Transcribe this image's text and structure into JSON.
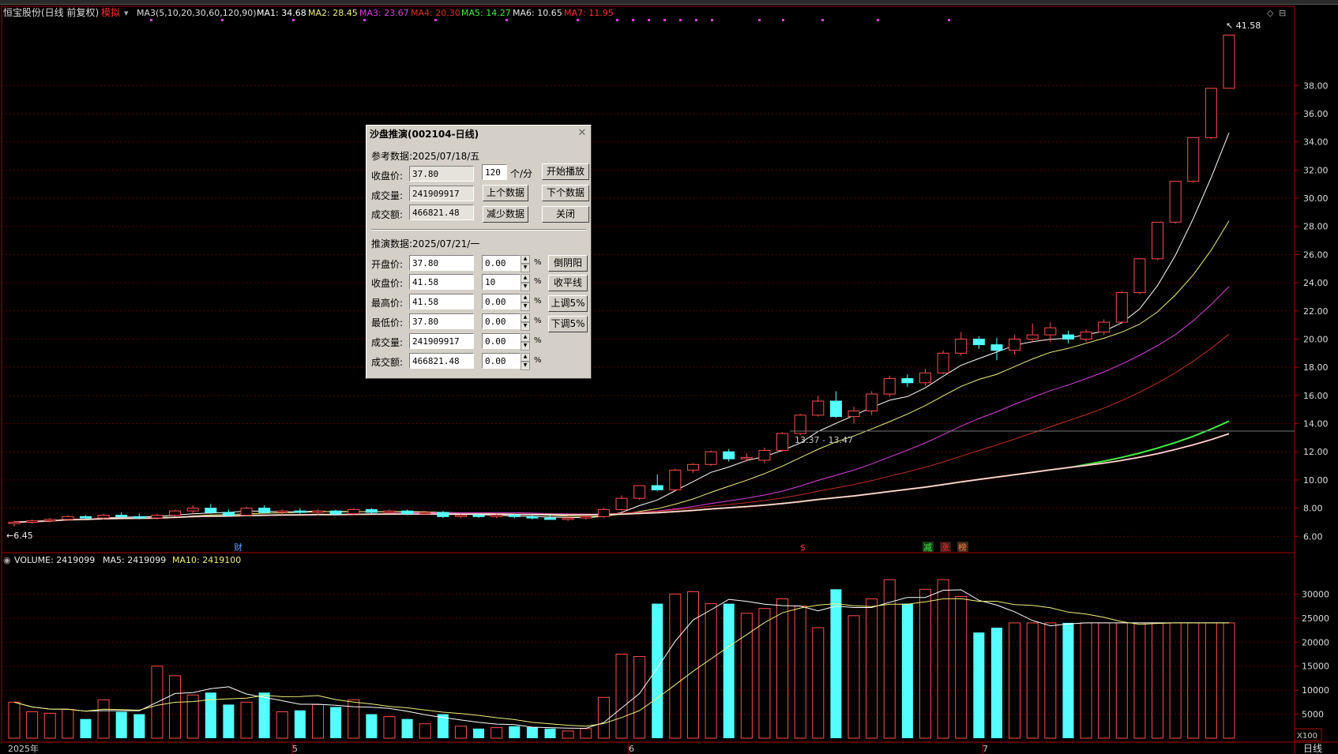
{
  "header": {
    "stock": "恒宝股份(日线 前复权)",
    "mode": "模拟",
    "ma_set": "MA3(5,10,20,30,60,120,90)",
    "ma": [
      {
        "label": "MA1: 34.68",
        "color": "#ffffff"
      },
      {
        "label": "MA2: 28.45",
        "color": "#f0f07a"
      },
      {
        "label": "MA3: 23.67",
        "color": "#e040e0"
      },
      {
        "label": "MA4: 20.30",
        "color": "#e03020"
      },
      {
        "label": "MA5: 14.27",
        "color": "#40f040"
      },
      {
        "label": "MA6: 10.65",
        "color": "#e8e8e8"
      },
      {
        "label": "MA7: 11.95",
        "color": "#ff3030"
      }
    ]
  },
  "price_axis": [
    "38.00",
    "36.00",
    "34.00",
    "32.00",
    "30.00",
    "28.00",
    "26.00",
    "24.00",
    "22.00",
    "20.00",
    "18.00",
    "16.00",
    "14.00",
    "12.00",
    "10.00",
    "8.00",
    "6.00"
  ],
  "price_ticks": [
    38,
    36,
    34,
    32,
    30,
    28,
    26,
    24,
    22,
    20,
    18,
    16,
    14,
    12,
    10,
    8,
    6
  ],
  "annotations": {
    "max": "41.58",
    "min": "6.45",
    "crosshair": "13.37 - 13.47",
    "marks": [
      {
        "text": "财",
        "color": "#5aa0ff"
      },
      {
        "text": "$",
        "color": "#ff3030"
      },
      {
        "text": "减",
        "color": "#40f040"
      },
      {
        "text": "涨",
        "color": "#ff3030"
      },
      {
        "text": "榜",
        "color": "#ff8040"
      }
    ]
  },
  "volume_header": {
    "volume": "VOLUME: 2419099",
    "ma5": "MA5: 2419099",
    "ma10": "MA10: 2419100"
  },
  "volume_axis": [
    "30000",
    "25000",
    "20000",
    "15000",
    "10000",
    "5000"
  ],
  "volume_ticks": [
    30000,
    25000,
    20000,
    15000,
    10000,
    5000
  ],
  "volume_unit": "X100",
  "time_axis": [
    {
      "label": "2025年"
    },
    {
      "label": "5"
    },
    {
      "label": "6"
    },
    {
      "label": "7"
    }
  ],
  "period": "日线",
  "chart_data": {
    "type": "candlestick",
    "bars": [
      {
        "o": 6.9,
        "h": 7.1,
        "l": 6.7,
        "c": 7.0,
        "v": 7500
      },
      {
        "o": 7.0,
        "h": 7.2,
        "l": 6.9,
        "c": 7.1,
        "v": 5500
      },
      {
        "o": 7.1,
        "h": 7.3,
        "l": 7.0,
        "c": 7.2,
        "v": 5200
      },
      {
        "o": 7.2,
        "h": 7.5,
        "l": 7.1,
        "c": 7.4,
        "v": 6000
      },
      {
        "o": 7.4,
        "h": 7.5,
        "l": 7.2,
        "c": 7.3,
        "v": 4000
      },
      {
        "o": 7.3,
        "h": 7.6,
        "l": 7.2,
        "c": 7.5,
        "v": 8000
      },
      {
        "o": 7.5,
        "h": 7.7,
        "l": 7.3,
        "c": 7.4,
        "v": 5500
      },
      {
        "o": 7.4,
        "h": 7.6,
        "l": 7.2,
        "c": 7.3,
        "v": 5000
      },
      {
        "o": 7.3,
        "h": 7.6,
        "l": 7.2,
        "c": 7.5,
        "v": 15000
      },
      {
        "o": 7.5,
        "h": 7.9,
        "l": 7.4,
        "c": 7.8,
        "v": 13000
      },
      {
        "o": 7.8,
        "h": 8.2,
        "l": 7.6,
        "c": 8.0,
        "v": 9000
      },
      {
        "o": 8.0,
        "h": 8.3,
        "l": 7.6,
        "c": 7.7,
        "v": 9500
      },
      {
        "o": 7.7,
        "h": 7.9,
        "l": 7.4,
        "c": 7.5,
        "v": 7000
      },
      {
        "o": 7.5,
        "h": 8.1,
        "l": 7.4,
        "c": 8.0,
        "v": 7500
      },
      {
        "o": 8.0,
        "h": 8.2,
        "l": 7.6,
        "c": 7.7,
        "v": 9500
      },
      {
        "o": 7.7,
        "h": 7.9,
        "l": 7.5,
        "c": 7.8,
        "v": 5500
      },
      {
        "o": 7.8,
        "h": 8.0,
        "l": 7.6,
        "c": 7.7,
        "v": 5800
      },
      {
        "o": 7.7,
        "h": 7.9,
        "l": 7.5,
        "c": 7.8,
        "v": 7000
      },
      {
        "o": 7.8,
        "h": 7.9,
        "l": 7.5,
        "c": 7.6,
        "v": 6500
      },
      {
        "o": 7.6,
        "h": 8.0,
        "l": 7.5,
        "c": 7.9,
        "v": 8000
      },
      {
        "o": 7.9,
        "h": 8.0,
        "l": 7.6,
        "c": 7.7,
        "v": 5000
      },
      {
        "o": 7.7,
        "h": 7.9,
        "l": 7.6,
        "c": 7.8,
        "v": 4500
      },
      {
        "o": 7.8,
        "h": 7.9,
        "l": 7.5,
        "c": 7.6,
        "v": 4000
      },
      {
        "o": 7.6,
        "h": 7.8,
        "l": 7.5,
        "c": 7.7,
        "v": 3000
      },
      {
        "o": 7.7,
        "h": 7.8,
        "l": 7.3,
        "c": 7.4,
        "v": 5000
      },
      {
        "o": 7.4,
        "h": 7.6,
        "l": 7.3,
        "c": 7.5,
        "v": 2500
      },
      {
        "o": 7.5,
        "h": 7.6,
        "l": 7.3,
        "c": 7.4,
        "v": 2000
      },
      {
        "o": 7.4,
        "h": 7.6,
        "l": 7.3,
        "c": 7.5,
        "v": 2200
      },
      {
        "o": 7.5,
        "h": 7.6,
        "l": 7.3,
        "c": 7.4,
        "v": 2500
      },
      {
        "o": 7.4,
        "h": 7.5,
        "l": 7.2,
        "c": 7.3,
        "v": 2300
      },
      {
        "o": 7.3,
        "h": 7.5,
        "l": 7.2,
        "c": 7.2,
        "v": 2000
      },
      {
        "o": 7.2,
        "h": 7.4,
        "l": 7.1,
        "c": 7.3,
        "v": 1500
      },
      {
        "o": 7.3,
        "h": 7.5,
        "l": 7.2,
        "c": 7.4,
        "v": 2000
      },
      {
        "o": 7.4,
        "h": 8.0,
        "l": 7.3,
        "c": 7.9,
        "v": 8500
      },
      {
        "o": 7.9,
        "h": 8.9,
        "l": 7.8,
        "c": 8.7,
        "v": 17500
      },
      {
        "o": 8.7,
        "h": 9.6,
        "l": 8.6,
        "c": 9.6,
        "v": 17000
      },
      {
        "o": 9.6,
        "h": 10.4,
        "l": 9.2,
        "c": 9.3,
        "v": 28000
      },
      {
        "o": 9.3,
        "h": 10.8,
        "l": 9.2,
        "c": 10.7,
        "v": 30000
      },
      {
        "o": 10.7,
        "h": 11.2,
        "l": 10.5,
        "c": 11.1,
        "v": 30500
      },
      {
        "o": 11.1,
        "h": 12.1,
        "l": 11.0,
        "c": 12.0,
        "v": 28000
      },
      {
        "o": 12.0,
        "h": 12.2,
        "l": 11.3,
        "c": 11.5,
        "v": 28000
      },
      {
        "o": 11.5,
        "h": 11.9,
        "l": 11.3,
        "c": 11.6,
        "v": 26000
      },
      {
        "o": 11.4,
        "h": 12.3,
        "l": 11.2,
        "c": 12.1,
        "v": 27000
      },
      {
        "o": 12.1,
        "h": 13.4,
        "l": 12.0,
        "c": 13.3,
        "v": 29000
      },
      {
        "o": 13.3,
        "h": 14.7,
        "l": 13.2,
        "c": 14.6,
        "v": 27500
      },
      {
        "o": 14.6,
        "h": 16.0,
        "l": 14.5,
        "c": 15.6,
        "v": 23000
      },
      {
        "o": 15.6,
        "h": 16.3,
        "l": 14.4,
        "c": 14.5,
        "v": 31000
      },
      {
        "o": 14.5,
        "h": 15.2,
        "l": 14.0,
        "c": 14.9,
        "v": 25500
      },
      {
        "o": 14.9,
        "h": 16.3,
        "l": 14.6,
        "c": 16.1,
        "v": 29000
      },
      {
        "o": 16.1,
        "h": 17.4,
        "l": 15.9,
        "c": 17.2,
        "v": 33000
      },
      {
        "o": 17.2,
        "h": 17.5,
        "l": 16.6,
        "c": 16.9,
        "v": 28000
      },
      {
        "o": 16.9,
        "h": 17.9,
        "l": 16.7,
        "c": 17.6,
        "v": 31000
      },
      {
        "o": 17.6,
        "h": 19.2,
        "l": 17.5,
        "c": 19.0,
        "v": 33000
      },
      {
        "o": 19.0,
        "h": 20.5,
        "l": 18.8,
        "c": 20.0,
        "v": 29500
      },
      {
        "o": 20.0,
        "h": 20.2,
        "l": 19.3,
        "c": 19.6,
        "v": 22000
      },
      {
        "o": 19.6,
        "h": 20.1,
        "l": 18.5,
        "c": 19.2,
        "v": 23000
      },
      {
        "o": 19.2,
        "h": 20.3,
        "l": 18.9,
        "c": 20.0,
        "v": 24000
      },
      {
        "o": 20.0,
        "h": 21.1,
        "l": 19.8,
        "c": 20.3,
        "v": 24000
      },
      {
        "o": 20.3,
        "h": 21.2,
        "l": 19.8,
        "c": 20.8,
        "v": 24000
      },
      {
        "o": 20.3,
        "h": 20.6,
        "l": 19.7,
        "c": 20.0,
        "v": 24000
      },
      {
        "o": 20.0,
        "h": 20.7,
        "l": 19.8,
        "c": 20.5,
        "v": 24000
      },
      {
        "o": 20.5,
        "h": 21.4,
        "l": 20.3,
        "c": 21.2,
        "v": 24000
      },
      {
        "o": 21.2,
        "h": 23.4,
        "l": 21.1,
        "c": 23.3,
        "v": 24000
      },
      {
        "o": 23.3,
        "h": 25.7,
        "l": 23.2,
        "c": 25.7,
        "v": 24000
      },
      {
        "o": 25.7,
        "h": 28.3,
        "l": 25.6,
        "c": 28.3,
        "v": 24000
      },
      {
        "o": 28.3,
        "h": 31.2,
        "l": 28.2,
        "c": 31.2,
        "v": 24000
      },
      {
        "o": 31.2,
        "h": 34.3,
        "l": 31.1,
        "c": 34.3,
        "v": 24000
      },
      {
        "o": 34.3,
        "h": 37.8,
        "l": 34.2,
        "c": 37.8,
        "v": 24000
      },
      {
        "o": 37.8,
        "h": 41.58,
        "l": 37.8,
        "c": 41.58,
        "v": 24000
      }
    ],
    "y_range": [
      5.4,
      42.5
    ],
    "volume_range": [
      0,
      35000
    ]
  },
  "dialog": {
    "title": "沙盘推演(002104-日线)",
    "ref_label": "参考数据:2025/07/18/五",
    "close_label": "收盘价:",
    "close_val": "37.80",
    "vol_label": "成交量:",
    "vol_val": "241909917",
    "amt_label": "成交额:",
    "amt_val": "466821.48",
    "speed_val": "120",
    "speed_unit": "个/分",
    "btn_play": "开始播放",
    "btn_prev": "上个数据",
    "btn_next": "下个数据",
    "btn_reduce": "减少数据",
    "btn_close": "关闭",
    "sim_label": "推演数据:2025/07/21/一",
    "rows": [
      {
        "label": "开盘价:",
        "val": "37.80",
        "pct": "0.00"
      },
      {
        "label": "收盘价:",
        "val": "41.58",
        "pct": "10"
      },
      {
        "label": "最高价:",
        "val": "41.58",
        "pct": "0.00"
      },
      {
        "label": "最低价:",
        "val": "37.80",
        "pct": "0.00"
      },
      {
        "label": "成交量:",
        "val": "241909917",
        "pct": "0.00"
      },
      {
        "label": "成交额:",
        "val": "466821.48",
        "pct": "0.00"
      }
    ],
    "pct_sign": "%",
    "btn_invert": "倒阴阳",
    "btn_flat": "收平线",
    "btn_up5": "上调5%",
    "btn_down5": "下调5%"
  }
}
